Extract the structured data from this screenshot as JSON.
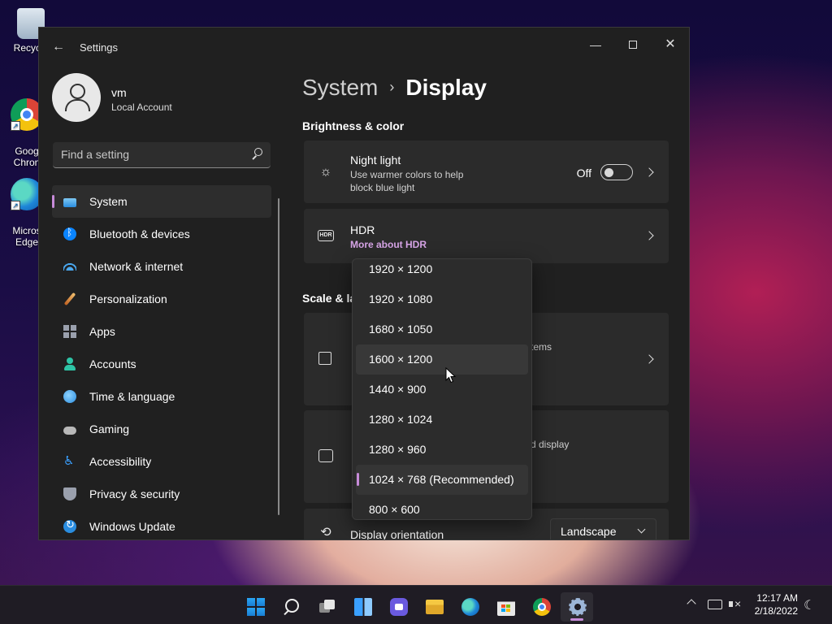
{
  "desktop": {
    "icons": [
      {
        "label": "Recycle",
        "icon": "recycle-bin-icon"
      },
      {
        "label": "Goog\nChron",
        "icon": "chrome-icon"
      },
      {
        "label": "Micros\nEdge",
        "icon": "edge-icon"
      }
    ]
  },
  "window": {
    "title": "Settings",
    "controls": {
      "minimize": "—",
      "close": "✕"
    }
  },
  "profile": {
    "name": "vm",
    "account_type": "Local Account"
  },
  "search": {
    "placeholder": "Find a setting"
  },
  "sidebar": {
    "items": [
      {
        "label": "System",
        "icon": "system-icon",
        "active": true
      },
      {
        "label": "Bluetooth & devices",
        "icon": "bluetooth-icon"
      },
      {
        "label": "Network & internet",
        "icon": "wifi-icon"
      },
      {
        "label": "Personalization",
        "icon": "brush-icon"
      },
      {
        "label": "Apps",
        "icon": "apps-icon"
      },
      {
        "label": "Accounts",
        "icon": "accounts-icon"
      },
      {
        "label": "Time & language",
        "icon": "globe-icon"
      },
      {
        "label": "Gaming",
        "icon": "gamepad-icon"
      },
      {
        "label": "Accessibility",
        "icon": "accessibility-icon"
      },
      {
        "label": "Privacy & security",
        "icon": "shield-icon"
      },
      {
        "label": "Windows Update",
        "icon": "update-icon"
      }
    ]
  },
  "breadcrumb": {
    "parent": "System",
    "separator": "›",
    "current": "Display"
  },
  "sections": {
    "brightness": "Brightness & color",
    "scale": "Scale & la"
  },
  "night_light": {
    "title": "Night light",
    "description": "Use warmer colors to help block blue light",
    "toggle_label": "Off",
    "toggle_on": false
  },
  "hdr": {
    "title": "HDR",
    "link": "More about HDR",
    "badge": "HDR"
  },
  "scale_card": {
    "partial_text": "tems"
  },
  "multi_card": {
    "partial_text": "d display"
  },
  "orientation": {
    "title": "Display orientation",
    "value": "Landscape"
  },
  "resolution_dropdown": {
    "options": [
      "1920 × 1200",
      "1920 × 1080",
      "1680 × 1050",
      "1600 × 1200",
      "1440 × 900",
      "1280 × 1024",
      "1280 × 960",
      "1024 × 768 (Recommended)",
      "800 × 600"
    ],
    "selected": "1024 × 768 (Recommended)",
    "hovered": "1600 × 1200"
  },
  "taskbar": {
    "apps": [
      "start-icon",
      "search-icon",
      "task-view-icon",
      "widgets-icon",
      "chat-icon",
      "file-explorer-icon",
      "edge-icon",
      "store-icon",
      "chrome-icon",
      "settings-icon"
    ],
    "active_app": "settings-icon"
  },
  "clock": {
    "time": "12:17 AM",
    "date": "2/18/2022"
  },
  "colors": {
    "accent": "#c78bd9",
    "window_bg": "#202020",
    "card_bg": "#2b2b2b"
  }
}
